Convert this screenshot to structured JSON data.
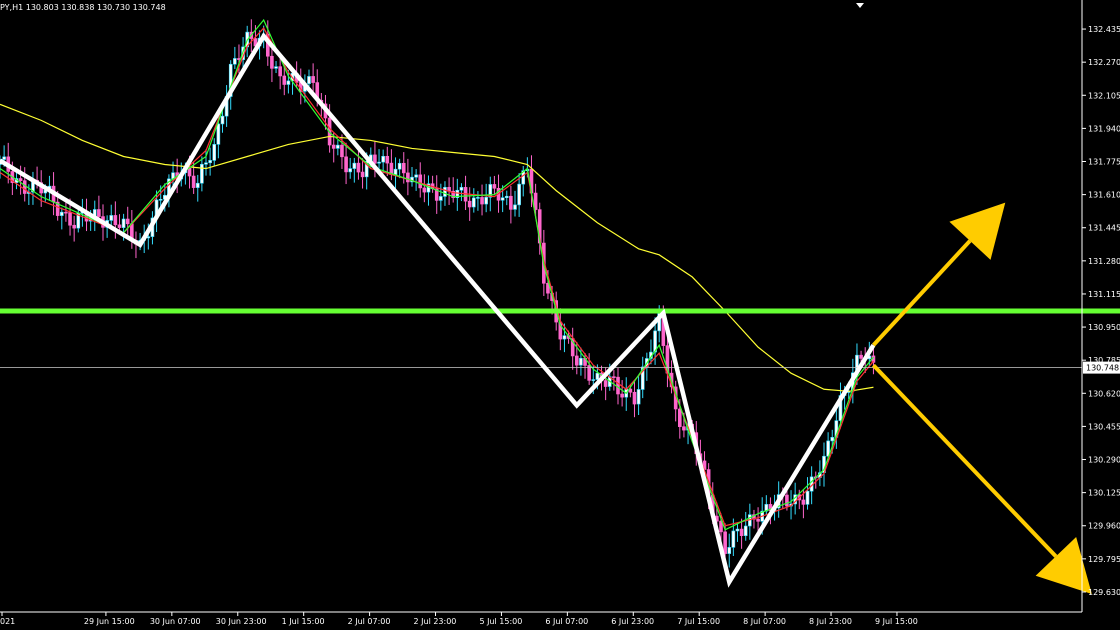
{
  "header": {
    "symbol_timeframe": "PY,H1",
    "ohlc": "130.803 130.838 130.730 130.748"
  },
  "chart_data": {
    "type": "candlestick",
    "timeframe": "H1",
    "ylim": [
      129.58,
      132.52
    ],
    "y_ticks": [
      "132.435",
      "132.270",
      "132.105",
      "131.940",
      "131.775",
      "131.610",
      "131.445",
      "131.280",
      "131.115",
      "130.950",
      "130.785",
      "130.620",
      "130.455",
      "130.290",
      "130.125",
      "129.960",
      "129.795",
      "129.630"
    ],
    "x_ticks": [
      "021",
      "29 Jun 15:00",
      "30 Jun 07:00",
      "30 Jun 23:00",
      "1 Jul 15:00",
      "2 Jul 07:00",
      "2 Jul 23:00",
      "5 Jul 15:00",
      "6 Jul 07:00",
      "6 Jul 23:00",
      "7 Jul 15:00",
      "8 Jul 07:00",
      "8 Jul 23:00",
      "9 Jul 15:00"
    ],
    "x_tick_index": [
      0,
      16,
      32,
      48,
      64,
      80,
      96,
      112,
      128,
      144,
      160,
      176,
      192,
      208
    ],
    "current_price": "130.748",
    "current_price_value": 130.748,
    "horizontal_levels": [
      {
        "value": 131.03,
        "color": "#66ff33"
      }
    ],
    "close_path": [
      [
        0,
        131.76
      ],
      [
        6,
        131.66
      ],
      [
        12,
        131.61
      ],
      [
        18,
        131.46
      ],
      [
        24,
        131.52
      ],
      [
        30,
        131.44
      ],
      [
        34,
        131.37
      ],
      [
        38,
        131.54
      ],
      [
        44,
        131.76
      ],
      [
        48,
        131.66
      ],
      [
        52,
        131.84
      ],
      [
        56,
        132.25
      ],
      [
        60,
        132.36
      ],
      [
        64,
        132.4
      ],
      [
        68,
        132.17
      ],
      [
        72,
        132.16
      ],
      [
        76,
        132.2
      ],
      [
        80,
        131.86
      ],
      [
        84,
        131.78
      ],
      [
        88,
        131.72
      ],
      [
        92,
        131.79
      ],
      [
        96,
        131.76
      ],
      [
        100,
        131.66
      ],
      [
        104,
        131.66
      ],
      [
        108,
        131.6
      ],
      [
        112,
        131.61
      ],
      [
        116,
        131.59
      ],
      [
        120,
        131.61
      ],
      [
        124,
        131.57
      ],
      [
        128,
        131.75
      ],
      [
        130,
        131.48
      ],
      [
        132,
        131.2
      ],
      [
        134,
        131.07
      ],
      [
        136,
        130.94
      ],
      [
        140,
        130.76
      ],
      [
        144,
        130.72
      ],
      [
        148,
        130.68
      ],
      [
        150,
        130.61
      ],
      [
        154,
        130.62
      ],
      [
        160,
        130.96
      ],
      [
        164,
        130.54
      ],
      [
        168,
        130.4
      ],
      [
        172,
        130.12
      ],
      [
        176,
        129.86
      ],
      [
        180,
        129.92
      ],
      [
        184,
        130.04
      ],
      [
        188,
        130.06
      ],
      [
        192,
        130.08
      ],
      [
        196,
        130.14
      ],
      [
        200,
        130.26
      ],
      [
        204,
        130.6
      ],
      [
        208,
        130.76
      ],
      [
        210,
        130.8
      ],
      [
        212,
        130.748
      ]
    ],
    "ma_yellow": {
      "color": "#ffff33",
      "values": [
        [
          0,
          132.06
        ],
        [
          10,
          131.98
        ],
        [
          20,
          131.88
        ],
        [
          30,
          131.8
        ],
        [
          40,
          131.76
        ],
        [
          50,
          131.74
        ],
        [
          60,
          131.8
        ],
        [
          70,
          131.86
        ],
        [
          80,
          131.9
        ],
        [
          90,
          131.88
        ],
        [
          100,
          131.84
        ],
        [
          110,
          131.82
        ],
        [
          120,
          131.8
        ],
        [
          128,
          131.76
        ],
        [
          135,
          131.63
        ],
        [
          145,
          131.47
        ],
        [
          155,
          131.34
        ],
        [
          160,
          131.31
        ],
        [
          168,
          131.2
        ],
        [
          176,
          131.03
        ],
        [
          184,
          130.85
        ],
        [
          192,
          130.72
        ],
        [
          200,
          130.64
        ],
        [
          206,
          130.63
        ],
        [
          212,
          130.65
        ]
      ]
    },
    "ma_red": {
      "color": "#ff3333",
      "values": [
        [
          0,
          131.72
        ],
        [
          10,
          131.58
        ],
        [
          20,
          131.5
        ],
        [
          30,
          131.42
        ],
        [
          40,
          131.64
        ],
        [
          50,
          131.83
        ],
        [
          60,
          132.35
        ],
        [
          64,
          132.44
        ],
        [
          70,
          132.22
        ],
        [
          80,
          131.94
        ],
        [
          90,
          131.74
        ],
        [
          100,
          131.68
        ],
        [
          110,
          131.62
        ],
        [
          120,
          131.6
        ],
        [
          128,
          131.72
        ],
        [
          132,
          131.28
        ],
        [
          136,
          130.98
        ],
        [
          144,
          130.76
        ],
        [
          152,
          130.64
        ],
        [
          160,
          130.82
        ],
        [
          168,
          130.4
        ],
        [
          176,
          129.96
        ],
        [
          184,
          130.0
        ],
        [
          192,
          130.06
        ],
        [
          200,
          130.22
        ],
        [
          208,
          130.68
        ],
        [
          212,
          130.78
        ]
      ]
    },
    "ma_green": {
      "color": "#33ff33",
      "values": [
        [
          0,
          131.74
        ],
        [
          10,
          131.6
        ],
        [
          20,
          131.51
        ],
        [
          30,
          131.42
        ],
        [
          40,
          131.66
        ],
        [
          50,
          131.8
        ],
        [
          60,
          132.38
        ],
        [
          64,
          132.48
        ],
        [
          70,
          132.2
        ],
        [
          80,
          131.92
        ],
        [
          90,
          131.75
        ],
        [
          100,
          131.68
        ],
        [
          110,
          131.6
        ],
        [
          120,
          131.61
        ],
        [
          128,
          131.74
        ],
        [
          132,
          131.26
        ],
        [
          136,
          130.96
        ],
        [
          144,
          130.74
        ],
        [
          152,
          130.62
        ],
        [
          160,
          130.86
        ],
        [
          168,
          130.38
        ],
        [
          176,
          129.94
        ],
        [
          184,
          130.02
        ],
        [
          192,
          130.08
        ],
        [
          200,
          130.24
        ],
        [
          208,
          130.7
        ],
        [
          212,
          130.8
        ]
      ]
    },
    "zigzag": {
      "color": "#ffffff",
      "points": [
        [
          0,
          131.78
        ],
        [
          34,
          131.36
        ],
        [
          64,
          132.4
        ],
        [
          140,
          130.56
        ],
        [
          161,
          131.02
        ],
        [
          177,
          129.68
        ],
        [
          212,
          130.86
        ]
      ]
    },
    "projections": [
      {
        "color": "#ffcc00",
        "from": [
          212,
          130.86
        ],
        "to": [
          244,
          131.57
        ]
      },
      {
        "color": "#ffcc00",
        "from": [
          212,
          130.76
        ],
        "to": [
          265,
          129.62
        ]
      }
    ]
  }
}
